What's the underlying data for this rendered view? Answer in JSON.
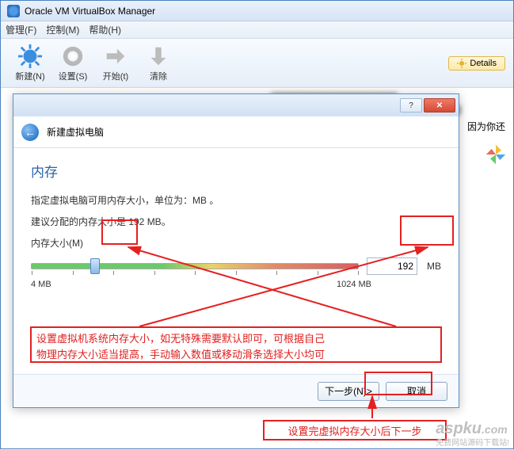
{
  "app": {
    "title": "Oracle VM VirtualBox Manager"
  },
  "menubar": {
    "items": [
      "管理(F)",
      "控制(M)",
      "帮助(H)"
    ]
  },
  "toolbar": {
    "new_label": "新建(N)",
    "settings_label": "设置(S)",
    "start_label": "开始(t)",
    "clear_label": "清除",
    "details_label": "Details"
  },
  "side_text": "因为你还",
  "dialog": {
    "wizard_title": "新建虚拟电脑",
    "heading": "内存",
    "desc": "指定虚拟电脑可用内存大小，单位为：MB 。",
    "recommend": "建议分配的内存大小是 192 MB。",
    "slider_label": "内存大小(M)",
    "min_label": "4 MB",
    "max_label": "1024 MB",
    "mem_value": "192",
    "mem_unit": "MB",
    "next_label": "下一步(N)>",
    "cancel_label": "取消",
    "slider_percent": 18
  },
  "annotations": {
    "note_line1": "设置虚拟机系统内存大小，如无特殊需要默认即可，可根据自己",
    "note_line2": "物理内存大小适当提高，手动输入数值或移动滑条选择大小均可",
    "footnote": "设置完虚拟内存大小后下一步"
  },
  "watermark": {
    "brand": "aspku",
    "tld": ".com",
    "slogan": "免费网站源码下载站!"
  }
}
